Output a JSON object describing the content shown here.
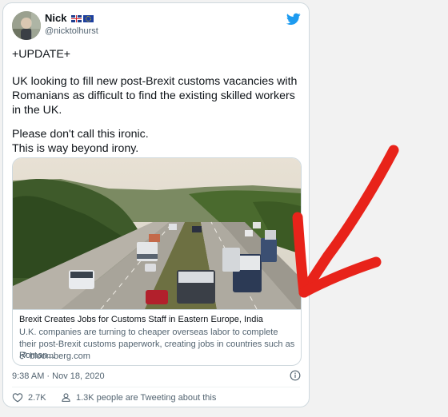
{
  "author": {
    "name": "Nick",
    "handle": "@nicktolhurst"
  },
  "tweet": {
    "line1": "+UPDATE+",
    "line2": "UK looking to fill new post-Brexit customs vacancies with Romanians as difficult to find the existing skilled workers in the UK.",
    "line3": "Please don't call this ironic.",
    "line4": "This is way beyond irony."
  },
  "card": {
    "title": "Brexit Creates Jobs for Customs Staff in Eastern Europe, India",
    "description": "U.K. companies are turning to cheaper overseas labor to complete their post-Brexit customs paperwork, creating jobs in countries such as Roman...",
    "link": "bloomberg.com"
  },
  "meta": {
    "timestamp": "9:38 AM · Nov 18, 2020",
    "likes": "2.7K",
    "tweeting_about": "1.3K people are Tweeting about this"
  },
  "colors": {
    "twitter_blue": "#1d9bf0",
    "annotation_red": "#e8231a",
    "muted_text": "#536471"
  },
  "icons": [
    "avatar",
    "uk-flag-icon",
    "eu-flag-icon",
    "twitter-bird-icon",
    "link-icon",
    "info-icon",
    "heart-icon",
    "person-icon",
    "red-arrow-annotation"
  ]
}
